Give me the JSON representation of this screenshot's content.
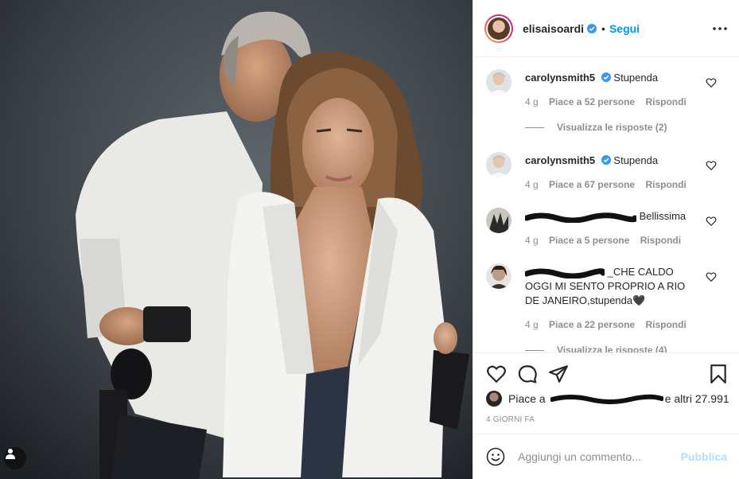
{
  "post": {
    "owner_username": "elisaisoardi",
    "separator": "•",
    "follow_label": "Segui"
  },
  "comments": [
    {
      "username": "carolynsmith5",
      "verified": true,
      "text": "Stupenda",
      "time": "4 g",
      "likes": "Piace a 52 persone",
      "reply_label": "Rispondi",
      "view_replies": "Visualizza le risposte (2)"
    },
    {
      "username": "carolynsmith5",
      "verified": true,
      "text": "Stupenda",
      "time": "4 g",
      "likes": "Piace a 67 persone",
      "reply_label": "Rispondi"
    },
    {
      "username": "",
      "redacted": true,
      "text": "Bellissima",
      "time": "4 g",
      "likes": "Piace a 5 persone",
      "reply_label": "Rispondi"
    },
    {
      "username": "",
      "redacted": true,
      "text": "_CHE CALDO OGGI MI SENTO PROPRIO A RIO DE JANEIRO,stupenda🖤",
      "time": "4 g",
      "likes": "Piace a 22 persone",
      "reply_label": "Rispondi",
      "view_replies": "Visualizza le risposte (4)"
    }
  ],
  "likes_summary": {
    "prefix": "Piace a",
    "suffix": "e altri 27.991"
  },
  "timestamp": "4 GIORNI FA",
  "composer": {
    "placeholder": "Aggiungi un commento...",
    "publish_label": "Pubblica"
  },
  "icons": {
    "like": "heart-icon",
    "comment": "comment-bubble-icon",
    "share": "paper-plane-icon",
    "save": "bookmark-icon",
    "emoji": "smiley-icon",
    "more": "more-dots-icon",
    "tag": "user-tag-icon"
  },
  "colors": {
    "accent": "#0095f6",
    "publish_disabled": "#b2dffc",
    "muted": "#8e8e8e",
    "text": "#262626"
  }
}
